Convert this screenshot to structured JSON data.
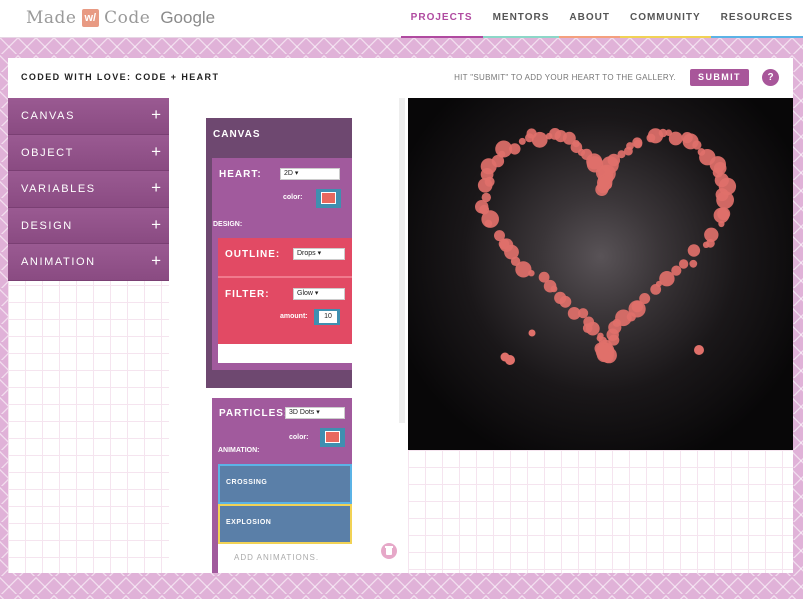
{
  "app": {
    "logo_made": "Made",
    "logo_w": "w/",
    "logo_code": "Code",
    "logo_google": "Google"
  },
  "nav": {
    "items": [
      "PROJECTS",
      "MENTORS",
      "ABOUT",
      "COMMUNITY",
      "RESOURCES"
    ],
    "active": "PROJECTS"
  },
  "project": {
    "title": "CODED WITH LOVE: CODE + HEART",
    "hint": "HIT \"SUBMIT\" TO ADD YOUR HEART TO THE GALLERY.",
    "submit_label": "SUBMIT",
    "help_label": "?"
  },
  "sidebar": {
    "items": [
      {
        "label": "CANVAS",
        "icon": "+"
      },
      {
        "label": "OBJECT",
        "icon": "+"
      },
      {
        "label": "VARIABLES",
        "icon": "+"
      },
      {
        "label": "DESIGN",
        "icon": "+"
      },
      {
        "label": "ANIMATION",
        "icon": "+"
      }
    ]
  },
  "blocks": {
    "canvas_label": "CANVAS",
    "heart": {
      "label": "HEART:",
      "mode": "2D",
      "color_label": "color:",
      "color": "#e8685e",
      "design_label": "DESIGN:",
      "outline_label": "OUTLINE:",
      "outline_value": "Drops",
      "filter_label": "FILTER:",
      "filter_value": "Glow",
      "amount_label": "amount:",
      "amount_value": "10"
    },
    "particles": {
      "label": "PARTICLES:",
      "mode": "3D Dots",
      "color_label": "color:",
      "color": "#e8685e",
      "animation_label": "ANIMATION:",
      "crossing": "CROSSING",
      "explosion": "EXPLOSION",
      "add_animations": "ADD ANIMATIONS."
    }
  },
  "colors": {
    "accent": "#a8569a",
    "heart": "#e0706a",
    "crossing_border": "#5bb3e6",
    "explosion_border": "#f1d255"
  }
}
